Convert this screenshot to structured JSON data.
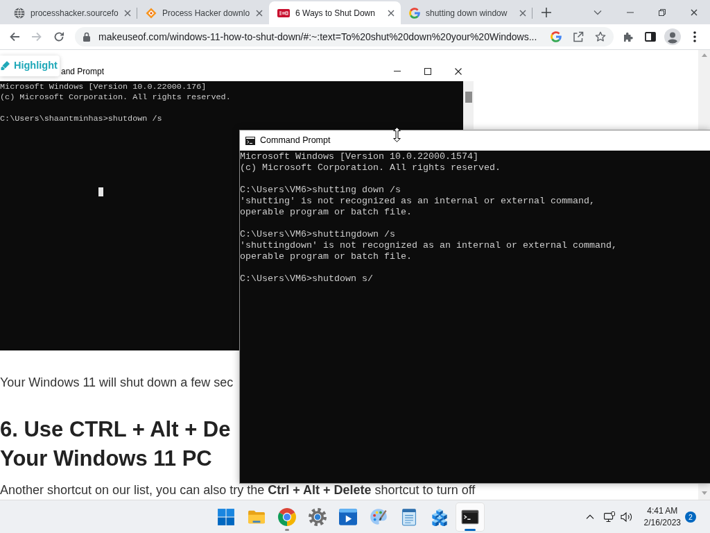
{
  "browser": {
    "tabs": [
      {
        "kind": "globe",
        "title": "processhacker.sourcefo",
        "selected": false
      },
      {
        "kind": "diamond",
        "title": "Process Hacker downlo",
        "selected": false
      },
      {
        "kind": "tile",
        "title": "6 Ways to Shut Down",
        "selected": true
      },
      {
        "kind": "letter",
        "title": "shutting down window",
        "selected": false
      }
    ],
    "nav_buttons": [
      {
        "kind": "back",
        "disabled": false
      },
      {
        "kind": "forward",
        "disabled": true
      },
      {
        "kind": "reload",
        "disabled": false
      }
    ],
    "url": "makeuseof.com/windows-11-how-to-shut-down/#:~:text=To%20shut%20down%20your%20Windows..."
  },
  "page": {
    "highlight_button": "Highlight",
    "screenshot": {
      "title": "and Prompt",
      "blocks": [
        [
          "Microsoft Windows [Version 10.0.22000.176]",
          "(c) Microsoft Corporation. All rights reserved."
        ],
        [
          "C:\\Users\\shaantminhas>shutdown /s"
        ]
      ]
    },
    "intro": "Your Windows 11 will shut down a few sec",
    "heading": [
      "6. Use CTRL + Alt + De",
      "Your Windows 11 PC"
    ],
    "body": "Another shortcut on our list, you can also try the **Ctrl + Alt + Delete** shortcut to turn off"
  },
  "command_prompt": {
    "title": "Command Prompt",
    "blocks": [
      [
        "Microsoft Windows [Version 10.0.22000.1574]",
        "(c) Microsoft Corporation. All rights reserved."
      ],
      [
        "C:\\Users\\VM6>shutting down /s",
        "'shutting' is not recognized as an internal or external command,",
        "operable program or batch file."
      ],
      [
        "C:\\Users\\VM6>shuttingdown /s",
        "'shuttingdown' is not recognized as an internal or external command,",
        "operable program or batch file."
      ],
      [
        "C:\\Users\\VM6>shutdown s/"
      ]
    ]
  },
  "taskbar": {
    "apps": [
      {
        "kind": "start",
        "open": false,
        "selected": false
      },
      {
        "kind": "folder",
        "open": false,
        "selected": false
      },
      {
        "kind": "browser",
        "open": true,
        "selected": false
      },
      {
        "kind": "settings",
        "open": false,
        "selected": false
      },
      {
        "kind": "media",
        "open": false,
        "selected": false
      },
      {
        "kind": "paint",
        "open": false,
        "selected": false
      },
      {
        "kind": "notepad",
        "open": false,
        "selected": false
      },
      {
        "kind": "cubes",
        "open": false,
        "selected": false
      },
      {
        "kind": "terminal",
        "open": true,
        "selected": true
      }
    ],
    "clock": {
      "time": "4:41 AM",
      "date": "2/16/2023"
    },
    "notification_count": "2"
  }
}
